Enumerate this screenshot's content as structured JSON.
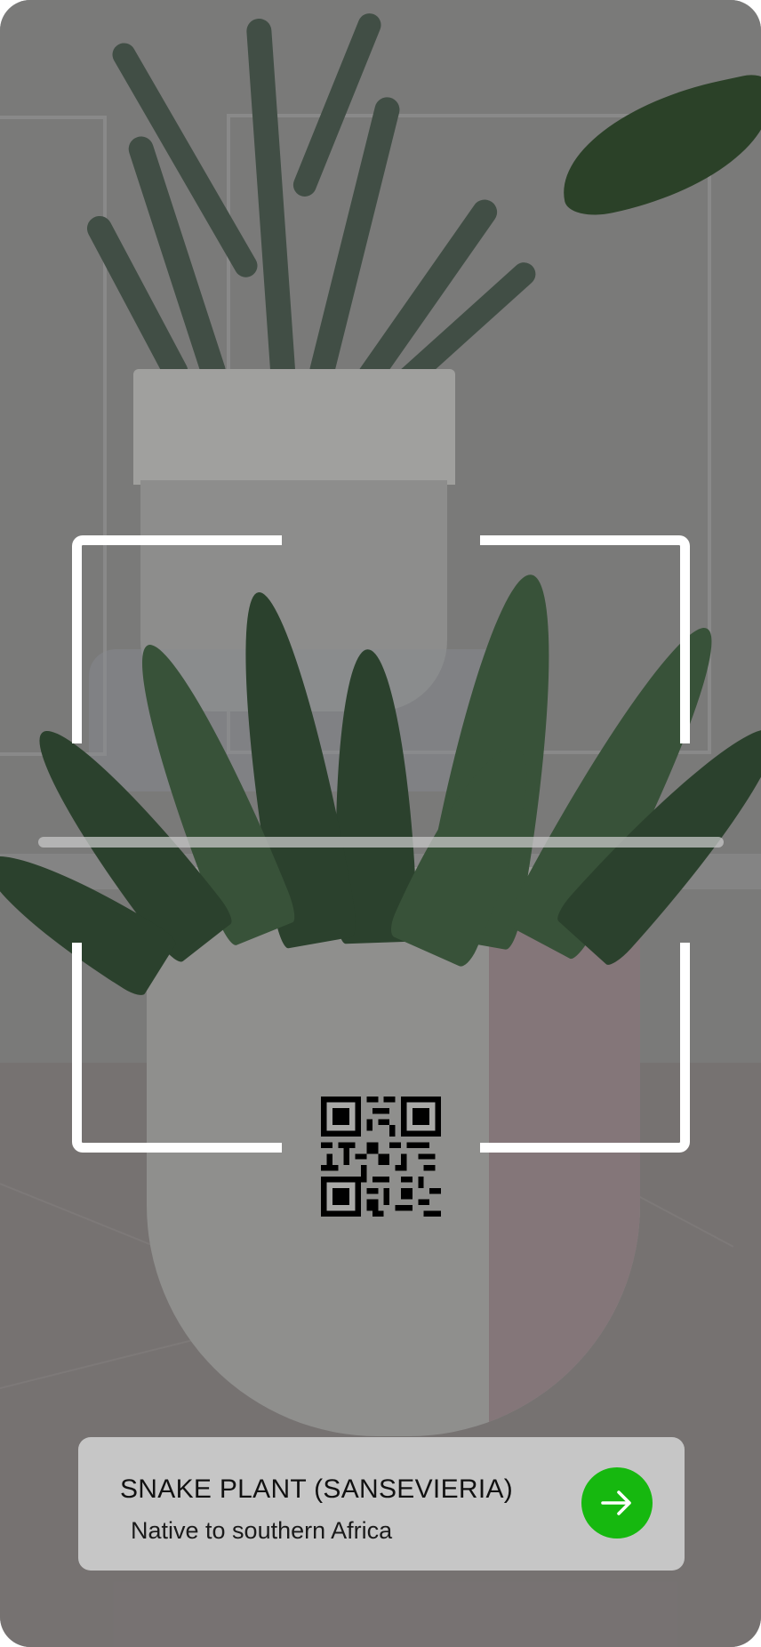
{
  "scanner": {
    "state": "scanning",
    "frame_color": "#ffffff"
  },
  "qr_code": {
    "icon": "qr-code-icon"
  },
  "result_card": {
    "title": "SNAKE PLANT (SANSEVIERIA)",
    "subtitle": "Native to southern Africa",
    "action_icon": "arrow-right-icon",
    "action_color": "#16b80f"
  }
}
